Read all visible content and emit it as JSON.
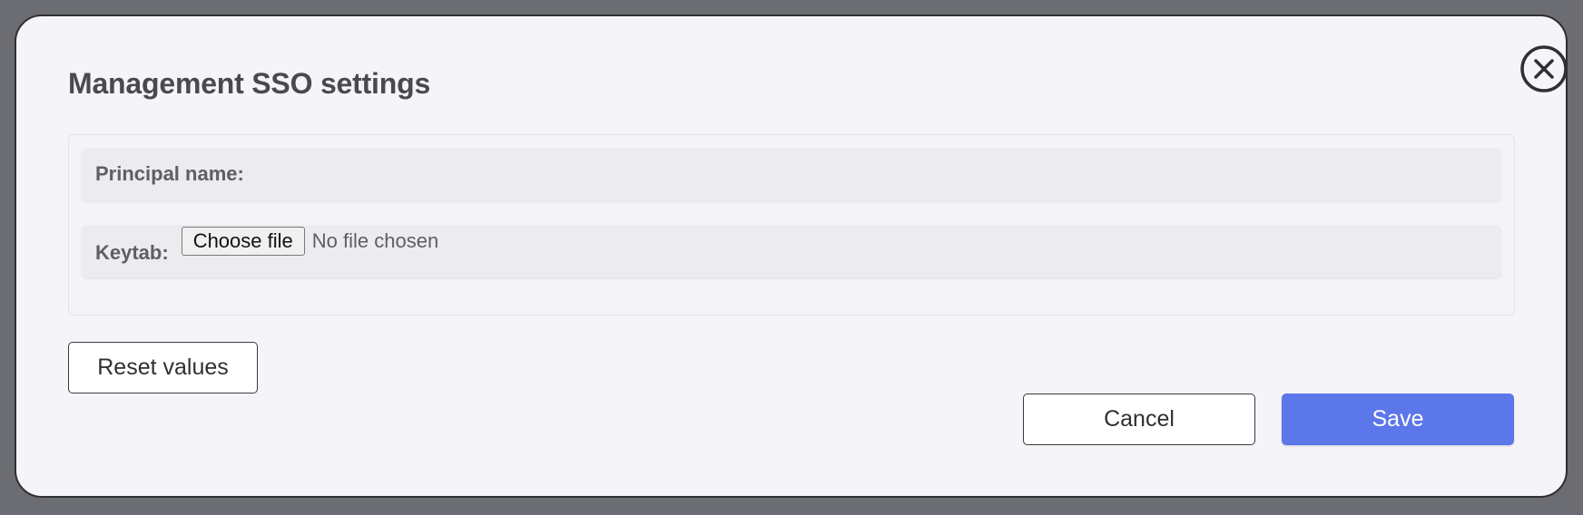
{
  "dialog": {
    "title": "Management SSO settings",
    "close_icon": "close-circle-icon"
  },
  "form": {
    "principal_name_label": "Principal name:",
    "keytab_label": "Keytab:",
    "choose_file_label": "Choose file",
    "file_status": "No file chosen"
  },
  "actions": {
    "reset_label": "Reset values",
    "cancel_label": "Cancel",
    "save_label": "Save"
  },
  "colors": {
    "accent": "#5c77ea",
    "modal_background": "#f5f5f9",
    "overlay": "#6c6d72"
  }
}
